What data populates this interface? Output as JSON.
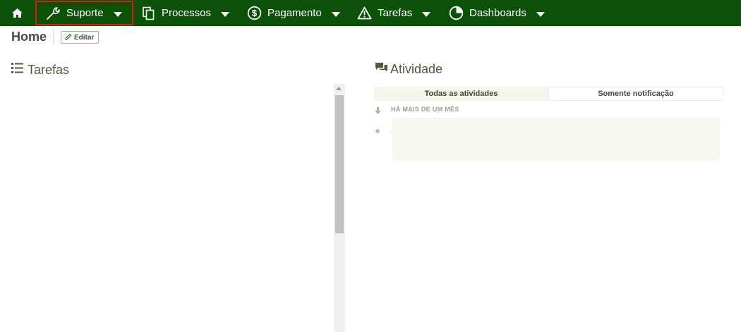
{
  "nav": {
    "home_icon": "home-icon",
    "items": [
      {
        "label": "Suporte",
        "icon": "wrench-icon"
      },
      {
        "label": "Processos",
        "icon": "copy-icon"
      },
      {
        "label": "Pagamento",
        "icon": "dollar-circle-icon"
      },
      {
        "label": "Tarefas",
        "icon": "warning-triangle-icon"
      },
      {
        "label": "Dashboards",
        "icon": "pie-chart-icon"
      }
    ]
  },
  "header": {
    "title": "Home",
    "edit_label": "Editar"
  },
  "tasks": {
    "title": "Tarefas",
    "icon": "list-icon"
  },
  "activity": {
    "title": "Atividade",
    "icon": "comments-icon",
    "tabs": [
      {
        "label": "Todas as atividades",
        "active": true
      },
      {
        "label": "Somente notificação",
        "active": false
      }
    ],
    "time_label": "HÁ MAIS DE UM MÊS"
  },
  "colors": {
    "nav_bg": "#0b5208",
    "highlight": "#e3141b",
    "accent": "#4d5a3e"
  }
}
